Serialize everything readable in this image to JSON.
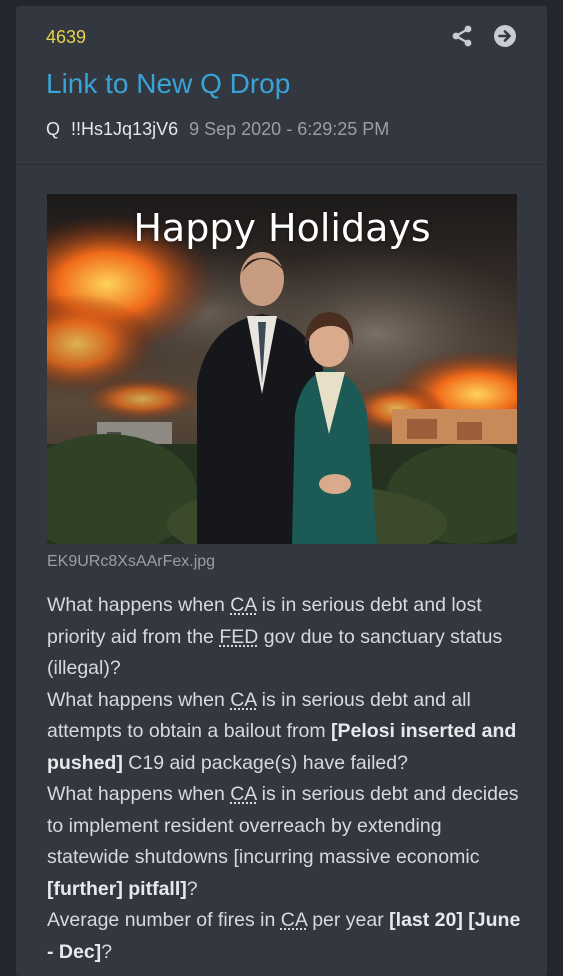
{
  "post": {
    "number": "4639",
    "title": "Link to New Q Drop",
    "author": "Q",
    "tripcode": "!!Hs1Jq13jV6",
    "date": "9 Sep 2020 - 6:29:25 PM"
  },
  "actions": {
    "share_icon": "share-icon",
    "goto_icon": "arrow-circle-right-icon"
  },
  "image": {
    "caption": "Happy Holidays",
    "filename": "EK9URc8XsAArFex.jpg"
  },
  "body": {
    "q1": {
      "a": "What happens when ",
      "ca": "CA",
      "b": " is in serious debt and lost priority aid from the ",
      "fed": "FED",
      "c": " gov due to sanctuary status (illegal)?"
    },
    "q2": {
      "a": "What happens when ",
      "ca": "CA",
      "b": " is in serious debt and all attempts to obtain a bailout from ",
      "bold1": "[Pelosi inserted and pushed]",
      "c": " C19 aid package(s) have failed?"
    },
    "q3": {
      "a": "What happens when ",
      "ca": "CA",
      "b": " is in serious debt and decides to implement resident overreach by extending statewide shutdowns [incurring massive economic ",
      "bold1": "[further]",
      "c": " ",
      "bold2": "pitfall]",
      "d": "?"
    },
    "q4": {
      "a": "Average number of fires in ",
      "ca": "CA",
      "b": " per year ",
      "bold1": "[last 20]",
      "c": " ",
      "bold2": "[June - Dec]",
      "d": "?"
    }
  }
}
